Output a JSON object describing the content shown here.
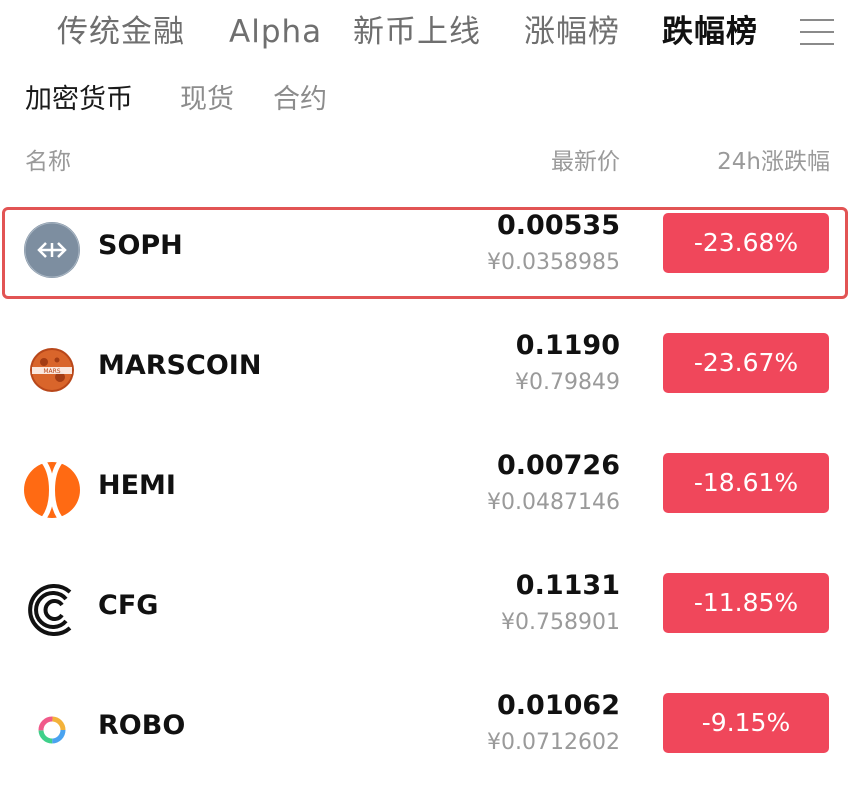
{
  "top_tabs": [
    "传统金融",
    "Alpha",
    "新币上线",
    "涨幅榜",
    "跌幅榜"
  ],
  "active_top_tab": "跌幅榜",
  "sub_tabs": [
    "加密货币",
    "现货",
    "合约"
  ],
  "active_sub_tab": "加密货币",
  "columns": {
    "name": "名称",
    "price": "最新价",
    "change": "24h涨跌幅"
  },
  "rows": [
    {
      "symbol": "SOPH",
      "price": "0.00535",
      "cny": "¥0.0358985",
      "change": "-23.68%",
      "icon": "soph-coin-icon",
      "highlighted": true
    },
    {
      "symbol": "MARSCOIN",
      "price": "0.1190",
      "cny": "¥0.79849",
      "change": "-23.67%",
      "icon": "marscoin-coin-icon",
      "highlighted": false
    },
    {
      "symbol": "HEMI",
      "price": "0.00726",
      "cny": "¥0.0487146",
      "change": "-18.61%",
      "icon": "hemi-coin-icon",
      "highlighted": false
    },
    {
      "symbol": "CFG",
      "price": "0.1131",
      "cny": "¥0.758901",
      "change": "-11.85%",
      "icon": "cfg-coin-icon",
      "highlighted": false
    },
    {
      "symbol": "ROBO",
      "price": "0.01062",
      "cny": "¥0.0712602",
      "change": "-9.15%",
      "icon": "robo-coin-icon",
      "highlighted": false
    }
  ],
  "colors": {
    "loss_badge": "#f0475b",
    "highlight_border": "#e25454"
  }
}
